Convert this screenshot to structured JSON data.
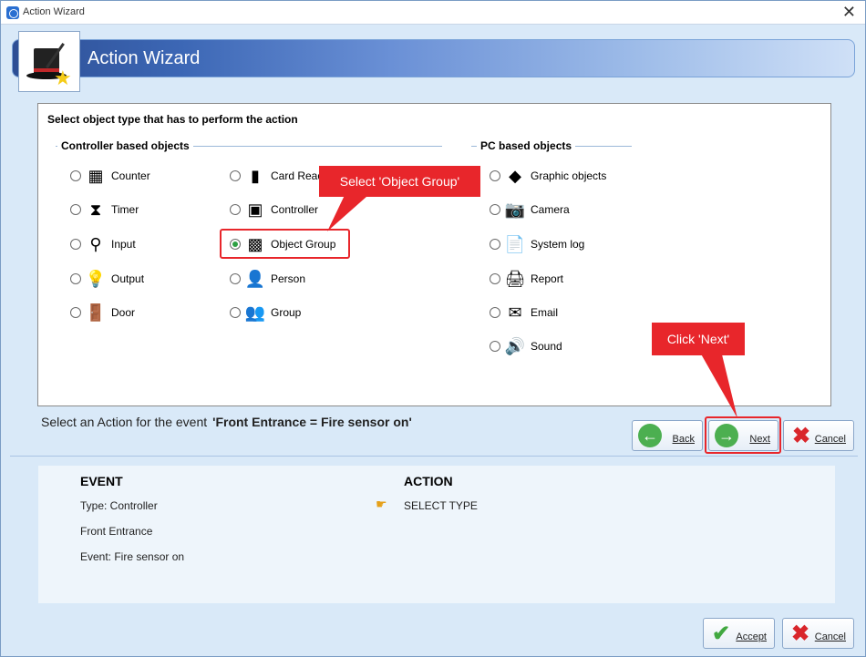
{
  "window": {
    "title": "Action Wizard",
    "close_glyph": "✕"
  },
  "banner": {
    "title": "Action Wizard",
    "icon": "magic-hat-icon"
  },
  "panel": {
    "heading": "Select object type that has to perform the action",
    "controller_group_title": "Controller based objects",
    "pc_group_title": "PC based objects",
    "controller_col1": [
      {
        "label": "Counter",
        "icon": "counter-icon",
        "glyph": "▦",
        "checked": false
      },
      {
        "label": "Timer",
        "icon": "hourglass-icon",
        "glyph": "⧗",
        "checked": false
      },
      {
        "label": "Input",
        "icon": "input-icon",
        "glyph": "⚲",
        "checked": false
      },
      {
        "label": "Output",
        "icon": "lightbulb-icon",
        "glyph": "💡",
        "checked": false
      },
      {
        "label": "Door",
        "icon": "door-icon",
        "glyph": "🚪",
        "checked": false
      }
    ],
    "controller_col2": [
      {
        "label": "Card Reader",
        "icon": "card-reader-icon",
        "glyph": "▮",
        "checked": false
      },
      {
        "label": "Controller",
        "icon": "controller-icon",
        "glyph": "▣",
        "checked": false
      },
      {
        "label": "Object Group",
        "icon": "object-group-icon",
        "glyph": "▩",
        "checked": true
      },
      {
        "label": "Person",
        "icon": "person-icon",
        "glyph": "👤",
        "checked": false
      },
      {
        "label": "Group",
        "icon": "group-icon",
        "glyph": "👥",
        "checked": false
      }
    ],
    "pc_col": [
      {
        "label": "Graphic objects",
        "icon": "graphic-objects-icon",
        "glyph": "◆",
        "checked": false
      },
      {
        "label": "Camera",
        "icon": "camera-icon",
        "glyph": "📷",
        "checked": false
      },
      {
        "label": "System log",
        "icon": "system-log-icon",
        "glyph": "📄",
        "checked": false
      },
      {
        "label": "Report",
        "icon": "printer-icon",
        "glyph": "🖨",
        "checked": false
      },
      {
        "label": "Email",
        "icon": "email-icon",
        "glyph": "✉",
        "checked": false
      },
      {
        "label": "Sound",
        "icon": "speaker-icon",
        "glyph": "🔊",
        "checked": false
      }
    ]
  },
  "callouts": {
    "object_group": "Select 'Object Group'",
    "next": "Click 'Next'"
  },
  "prompt": {
    "prefix": "Select an Action for the event",
    "event": "'Front Entrance = Fire sensor on'"
  },
  "nav_buttons": {
    "back": "Back",
    "next": "Next",
    "cancel": "Cancel"
  },
  "summary": {
    "event_heading": "EVENT",
    "action_heading": "ACTION",
    "event_type": "Type: Controller",
    "event_object": "Front Entrance",
    "event_name": "Event: Fire sensor on",
    "action_value": "SELECT TYPE"
  },
  "footer_buttons": {
    "accept": "Accept",
    "cancel": "Cancel"
  },
  "colors": {
    "callout": "#e8262b",
    "banner_dark": "#2d4e94",
    "window_bg": "#d9e9f8"
  }
}
